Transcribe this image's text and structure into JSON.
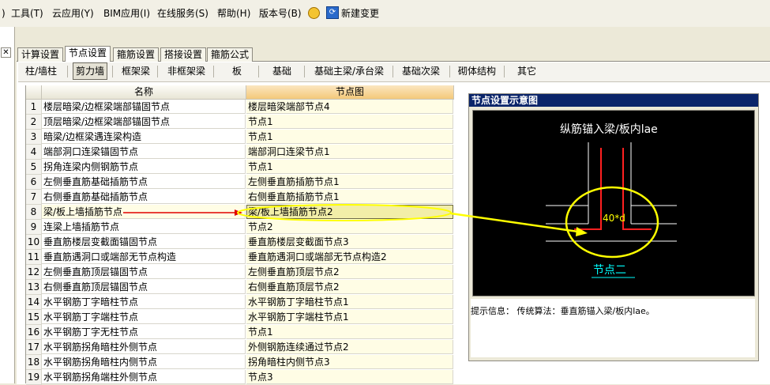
{
  "menu": [
    "工具(T)",
    "云应用(Y)",
    "BIM应用(I)",
    "在线服务(S)",
    "帮助(H)",
    "版本号(B)"
  ],
  "menu_prefix": ")",
  "toolbar_new_change": "新建变更",
  "tabs_top": [
    "计算设置",
    "节点设置",
    "箍筋设置",
    "搭接设置",
    "箍筋公式"
  ],
  "tabs_sub": [
    "柱/墙柱",
    "剪力墙",
    "框架梁",
    "非框架梁",
    "板",
    "基础",
    "基础主梁/承台梁",
    "基础次梁",
    "砌体结构",
    "其它"
  ],
  "table": {
    "headers": [
      "名称",
      "节点图"
    ],
    "rows": [
      {
        "no": "1",
        "name": "楼层暗梁/边框梁端部锚固节点",
        "node": "楼层暗梁端部节点4"
      },
      {
        "no": "2",
        "name": "顶层暗梁/边框梁端部锚固节点",
        "node": "节点1"
      },
      {
        "no": "3",
        "name": "暗梁/边框梁遇连梁构造",
        "node": "节点1"
      },
      {
        "no": "4",
        "name": "端部洞口连梁锚固节点",
        "node": "端部洞口连梁节点1"
      },
      {
        "no": "5",
        "name": "拐角连梁内侧钢筋节点",
        "node": "节点1"
      },
      {
        "no": "6",
        "name": "左侧垂直筋基础插筋节点",
        "node": "左侧垂直筋插筋节点1"
      },
      {
        "no": "7",
        "name": "右侧垂直筋基础插筋节点",
        "node": "右侧垂直筋插筋节点1"
      },
      {
        "no": "8",
        "name": "梁/板上墙插筋节点",
        "node": "梁/板上墙插筋节点2"
      },
      {
        "no": "9",
        "name": "连梁上墙插筋节点",
        "node": "节点2"
      },
      {
        "no": "10",
        "name": "垂直筋楼层变截面锚固节点",
        "node": "垂直筋楼层变截面节点3"
      },
      {
        "no": "11",
        "name": "垂直筋遇洞口或端部无节点构造",
        "node": "垂直筋遇洞口或端部无节点构造2"
      },
      {
        "no": "12",
        "name": "左侧垂直筋顶层锚固节点",
        "node": "左侧垂直筋顶层节点2"
      },
      {
        "no": "13",
        "name": "右侧垂直筋顶层锚固节点",
        "node": "右侧垂直筋顶层节点2"
      },
      {
        "no": "14",
        "name": "水平钢筋丁字暗柱节点",
        "node": "水平钢筋丁字暗柱节点1"
      },
      {
        "no": "15",
        "name": "水平钢筋丁字端柱节点",
        "node": "水平钢筋丁字端柱节点1"
      },
      {
        "no": "16",
        "name": "水平钢筋丁字无柱节点",
        "node": "节点1"
      },
      {
        "no": "17",
        "name": "水平钢筋拐角暗柱外侧节点",
        "node": "外侧钢筋连续通过节点2"
      },
      {
        "no": "18",
        "name": "水平钢筋拐角暗柱内侧节点",
        "node": "拐角暗柱内侧节点3"
      },
      {
        "no": "19",
        "name": "水平钢筋拐角端柱外侧节点",
        "node": "节点3"
      }
    ]
  },
  "diagram": {
    "title": "节点设置示意图",
    "top_label": "纵筋锚入梁/板内lae",
    "dim_label": "40*d",
    "node_label": "节点二",
    "info": "提示信息： 传统算法：垂直筋锚入梁/板内lae。"
  },
  "colors": {
    "highlight_col": "#fffde5",
    "selected_cell": "#f2eea8",
    "arrow_red": "#e00000",
    "arrow_yellow": "#ffff00",
    "title_bar": "#0a246a"
  }
}
